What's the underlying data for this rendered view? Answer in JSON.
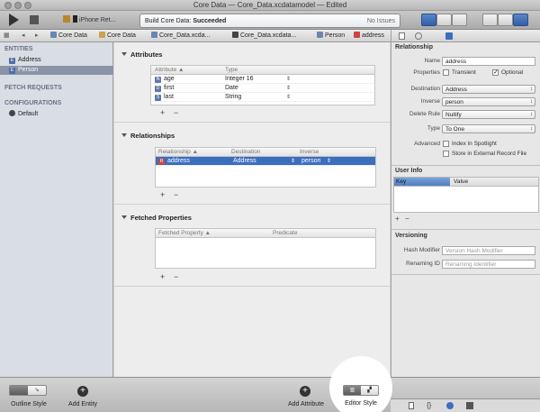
{
  "window": {
    "title": "Core Data — Core_Data.xcdatamodel — Edited"
  },
  "toolbar": {
    "scheme": "iPhone Ret...",
    "status_prefix": "Build Core Data: ",
    "status_state": "Succeeded",
    "issues": "No Issues"
  },
  "jumpbar": {
    "items": [
      "Core Data",
      "Core Data",
      "Core_Data.xcda...",
      "Core_Data.xcdata...",
      "Person",
      "address"
    ]
  },
  "sidebar": {
    "entities_header": "ENTITIES",
    "entities": [
      "Address",
      "Person"
    ],
    "fetch_header": "FETCH REQUESTS",
    "config_header": "CONFIGURATIONS",
    "configs": [
      "Default"
    ]
  },
  "attributes": {
    "title": "Attributes",
    "col_attr": "Attribute ▲",
    "col_type": "Type",
    "rows": [
      {
        "name": "age",
        "type": "Integer 16"
      },
      {
        "name": "first",
        "type": "Date"
      },
      {
        "name": "last",
        "type": "String"
      }
    ]
  },
  "relationships": {
    "title": "Relationships",
    "col_rel": "Relationship ▲",
    "col_dest": "Destination",
    "col_inv": "Inverse",
    "rows": [
      {
        "name": "address",
        "dest": "Address",
        "inverse": "person"
      }
    ]
  },
  "fetched": {
    "title": "Fetched Properties",
    "col_prop": "Fetched Property ▲",
    "col_pred": "Predicate"
  },
  "inspector": {
    "rel_header": "Relationship",
    "name_label": "Name",
    "name_value": "address",
    "props_label": "Properties",
    "transient": "Transient",
    "optional": "Optional",
    "dest_label": "Destination",
    "dest_value": "Address",
    "inv_label": "Inverse",
    "inv_value": "person",
    "del_label": "Delete Rule",
    "del_value": "Nullify",
    "type_label": "Type",
    "type_value": "To One",
    "adv_label": "Advanced",
    "index_spot": "Index in Spotlight",
    "ext_record": "Store in External Record File",
    "userinfo_header": "User Info",
    "key_col": "Key",
    "value_col": "Value",
    "version_header": "Versioning",
    "hash_label": "Hash Modifier",
    "hash_ph": "Version Hash Modifier",
    "renaming_label": "Renaming ID",
    "renaming_ph": "Renaming Identifier"
  },
  "bottom": {
    "outline_style": "Outline Style",
    "add_entity": "Add Entity",
    "add_attribute": "Add Attribute",
    "editor_style": "Editor Style"
  },
  "colors": {
    "selection": "#3c6ec0",
    "accent": "#2f5fa8"
  }
}
